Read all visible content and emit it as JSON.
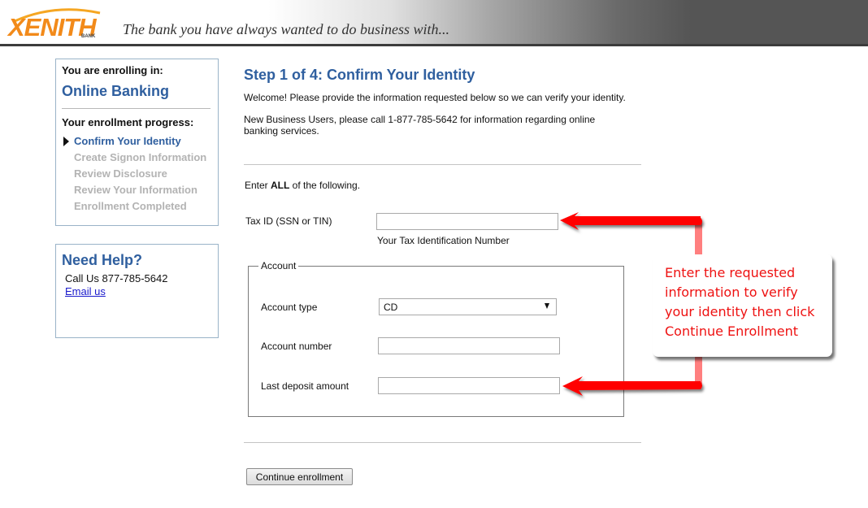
{
  "header": {
    "logo_text": "XENITH",
    "logo_subtext": "BANK",
    "tagline": "The bank you have always wanted to do business with...",
    "brand_color": "#f28a1a"
  },
  "sidebar": {
    "enrolling_label": "You are enrolling in:",
    "product": "Online Banking",
    "progress_heading": "Your enrollment progress:",
    "steps": [
      {
        "label": "Confirm Your Identity",
        "state": "current"
      },
      {
        "label": "Create Signon Information",
        "state": "pending"
      },
      {
        "label": "Review Disclosure",
        "state": "pending"
      },
      {
        "label": "Review Your Information",
        "state": "pending"
      },
      {
        "label": "Enrollment Completed",
        "state": "pending"
      }
    ],
    "help": {
      "title": "Need Help?",
      "call_text": "Call Us  877-785-5642",
      "email_link": "Email us"
    }
  },
  "main": {
    "step_title": "Step 1 of 4: Confirm Your Identity",
    "intro_1": "Welcome! Please provide the information requested below so we can verify your identity.",
    "intro_2": "New Business Users, please call 1-877-785-5642 for information regarding online banking services.",
    "enter_all_prefix": "Enter ",
    "enter_all_bold": "ALL",
    "enter_all_suffix": " of the following.",
    "tax_id": {
      "label": "Tax ID (SSN or TIN)",
      "value": "",
      "hint": "Your Tax Identification Number"
    },
    "account": {
      "legend": "Account",
      "type_label": "Account type",
      "type_value": "CD",
      "number_label": "Account number",
      "number_value": "",
      "deposit_label": "Last deposit amount",
      "deposit_value": ""
    },
    "continue_button": "Continue enrollment"
  },
  "annotation": {
    "callout_text": "Enter the requested information to verify your identity then click Continue Enrollment",
    "arrow_color": "#ff0000",
    "callout_text_color": "#ee1111"
  }
}
